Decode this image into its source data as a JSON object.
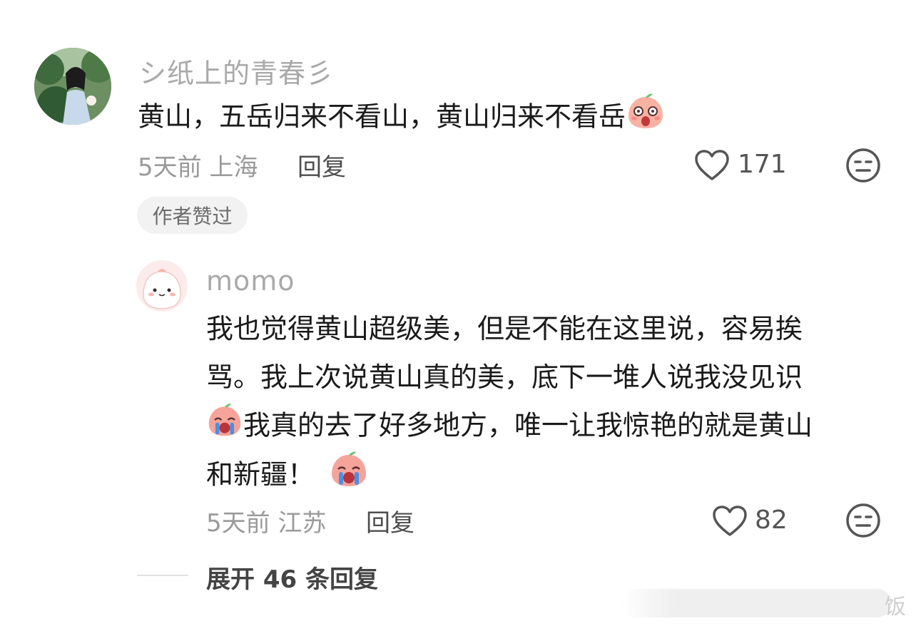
{
  "comment": {
    "username": "シ纸上的青春彡",
    "text": "黄山，五岳归来不看山，黄山归来不看岳",
    "emoji": "surprised-peach-emoji",
    "time": "5天前",
    "location": "上海",
    "reply_label": "回复",
    "like_count": "171",
    "badge": "作者赞过"
  },
  "reply": {
    "username": "momo",
    "lines": [
      "我也觉得黄山超级美，但是不能在这里说，容易挨",
      "骂。我上次说黄山真的美，底下一堆人说我没见识",
      "我真的去了好多地方，唯一让我惊艳的就是黄山",
      "和新疆！"
    ],
    "emoji": "crying-peach-emoji",
    "time": "5天前",
    "location": "江苏",
    "reply_label": "回复",
    "like_count": "82"
  },
  "expand_label": "展开 46 条回复",
  "watermark": "饭",
  "icons": {
    "like": "heart-outline-icon",
    "dislike": "meh-face-icon"
  },
  "colors": {
    "username": "#a9a9a9",
    "meta": "#9a9a9a",
    "badge_bg": "#f2f2f2",
    "peach": "#f6a39a"
  }
}
